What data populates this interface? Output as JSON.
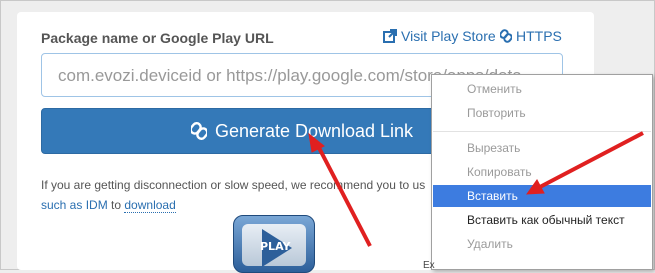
{
  "form": {
    "label": "Package name or Google Play URL",
    "visit_link": "Visit Play Store",
    "https_link": "HTTPS",
    "url_placeholder": "com.evozi.deviceid or https://play.google.com/store/apps/deta",
    "generate_button": "Generate Download Link",
    "info_line1": "If you are getting disconnection or slow speed, we recommend you to us",
    "info_line2_link1": "such as IDM",
    "info_line2_mid": " to ",
    "info_line2_link2": "download",
    "play_text": "PLAY"
  },
  "context_menu": {
    "items": [
      {
        "label": "Отменить"
      },
      {
        "label": "Повторить"
      },
      {
        "label": "Вырезать"
      },
      {
        "label": "Копировать"
      },
      {
        "label": "Вставить"
      },
      {
        "label": "Вставить как обычный текст"
      },
      {
        "label": "Удалить"
      }
    ],
    "cut_text": "Ex"
  },
  "colors": {
    "accent": "#3479b8",
    "link": "#2a6fb0",
    "menu_highlight": "#3d7ce0",
    "annotation_arrow": "#e02020"
  }
}
